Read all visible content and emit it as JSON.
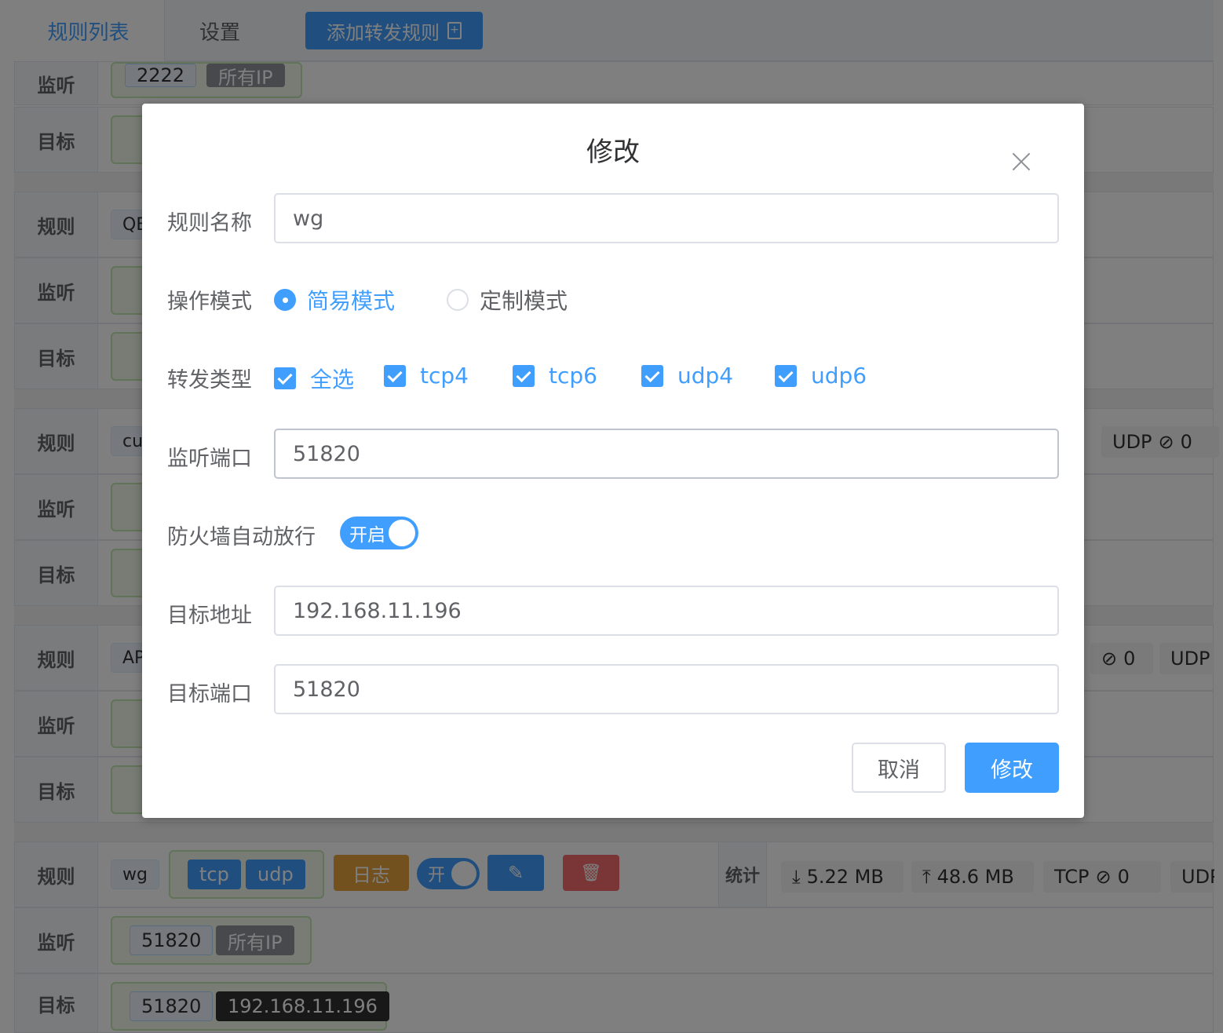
{
  "tabs": {
    "rules": "规则列表",
    "settings": "设置"
  },
  "add_rule_label": "添加转发规则",
  "row_labels": {
    "rule": "规则",
    "listen": "监听",
    "target": "目标",
    "stats": "统计"
  },
  "bg": {
    "listen1_port": "2222",
    "listen1_ip": "所有IP",
    "rule2_name": "QB",
    "rule3_name": "cu",
    "rule4_name": "AP",
    "udp": "UDP",
    "tcp": "TCP",
    "zero": "0"
  },
  "wg_row": {
    "name": "wg",
    "proto_tcp": "tcp",
    "proto_udp": "udp",
    "log": "日志",
    "switch_label": "开",
    "download": "5.22 MB",
    "upload": "48.6 MB",
    "listen_port": "51820",
    "listen_ip": "所有IP",
    "target_port": "51820",
    "target_ip": "192.168.11.196"
  },
  "dialog": {
    "title": "修改",
    "rule_name_label": "规则名称",
    "rule_name_value": "wg",
    "mode_label": "操作模式",
    "mode_simple": "简易模式",
    "mode_custom": "定制模式",
    "fwd_type_label": "转发类型",
    "fwd_types": [
      "全选",
      "tcp4",
      "tcp6",
      "udp4",
      "udp6"
    ],
    "listen_port_label": "监听端口",
    "listen_port_value": "51820",
    "firewall_label": "防火墙自动放行",
    "firewall_switch": "开启",
    "target_addr_label": "目标地址",
    "target_addr_value": "192.168.11.196",
    "target_port_label": "目标端口",
    "target_port_value": "51820",
    "cancel": "取消",
    "submit": "修改"
  },
  "colors": {
    "accent": "#409eff",
    "warning": "#e6a23c",
    "danger": "#f56c6c",
    "overlay": "rgba(0,0,0,0.5)"
  }
}
